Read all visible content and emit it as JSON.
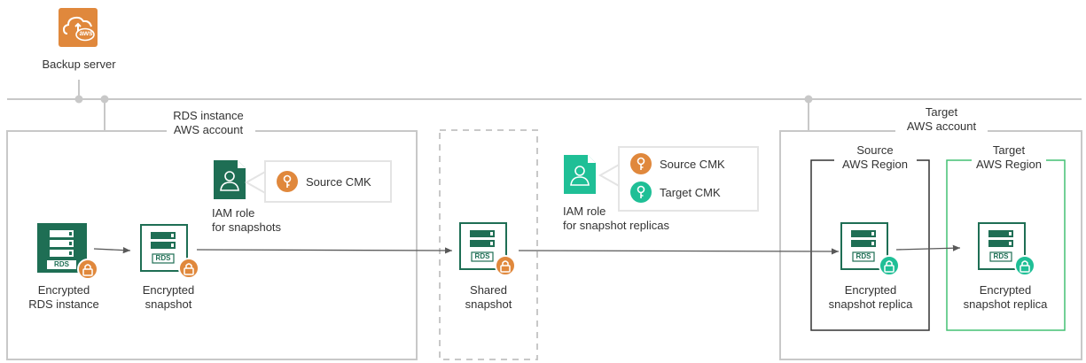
{
  "backup_server": {
    "label": "Backup server",
    "cloud_badge": "aws"
  },
  "rds_account": {
    "title_line1": "RDS instance",
    "title_line2": "AWS account"
  },
  "target_account": {
    "title_line1": "Target",
    "title_line2": "AWS account"
  },
  "source_region": {
    "title_line1": "Source",
    "title_line2": "AWS Region"
  },
  "target_region": {
    "title_line1": "Target",
    "title_line2": "AWS Region"
  },
  "iam_snapshots": {
    "line1": "IAM role",
    "line2": "for snapshots",
    "keys": [
      "Source CMK"
    ]
  },
  "iam_replicas": {
    "line1": "IAM role",
    "line2": "for snapshot replicas",
    "keys": [
      "Source CMK",
      "Target CMK"
    ]
  },
  "nodes": {
    "rds_instance": {
      "line1": "Encrypted",
      "line2": "RDS instance",
      "tag": "RDS"
    },
    "snapshot": {
      "line1": "Encrypted",
      "line2": "snapshot",
      "tag": "RDS"
    },
    "shared": {
      "line1": "Shared",
      "line2": "snapshot",
      "tag": "RDS"
    },
    "replica_source": {
      "line1": "Encrypted",
      "line2": "snapshot replica",
      "tag": "RDS"
    },
    "replica_target": {
      "line1": "Encrypted",
      "line2": "snapshot replica",
      "tag": "RDS"
    }
  },
  "colors": {
    "dark_green": "#1e6e54",
    "teal": "#1fbf96",
    "orange": "#e0883c",
    "line_gray": "#c8c8c8",
    "arrow_gray": "#595959",
    "region_green": "#44c174"
  }
}
